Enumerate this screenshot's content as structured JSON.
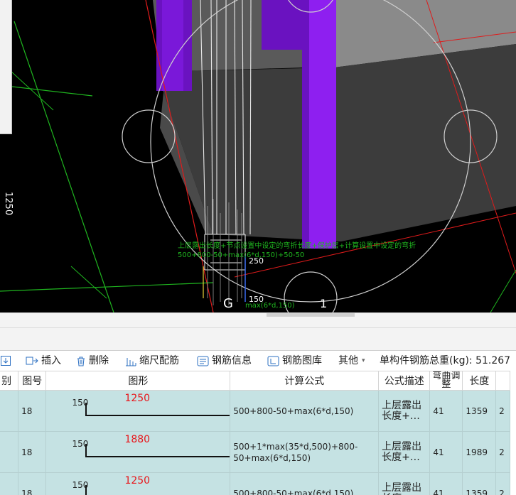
{
  "viewport": {
    "labels": {
      "axis_g": "G",
      "axis_1": "1",
      "dim_250": "250",
      "dim_150": "150",
      "side_mark": "1250",
      "note_line1": "上层露出长度+节点设置中设定的弯折长度+保护层+计算设置中设定的弯折",
      "note_line2": "500+800-50+max(6*d,150)+50-50",
      "formula_near_dim": "max(6*d,150)"
    }
  },
  "toolbar": {
    "insert": "插入",
    "delete": "删除",
    "scale_rebar": "缩尺配筋",
    "rebar_info": "钢筋信息",
    "rebar_library": "钢筋图库",
    "other": "其他",
    "weight_label": "单构件钢筋总重(kg):",
    "weight_value": "51.267"
  },
  "table": {
    "headers": {
      "type": "别",
      "figure_no": "图号",
      "shape": "图形",
      "formula": "计算公式",
      "desc": "公式描述",
      "bend_adjust": "弯曲调整",
      "length": "长度",
      "extra": ""
    },
    "rows": [
      {
        "type": "",
        "figure_no": "18",
        "shape_side": "150",
        "shape_value": "1250",
        "formula": "500+800-50+max(6*d,150)",
        "desc": "上层露出长度+…",
        "bend": "41",
        "length": "1359",
        "extra": "2"
      },
      {
        "type": "",
        "figure_no": "18",
        "shape_side": "150",
        "shape_value": "1880",
        "formula": "500+1*max(35*d,500)+800-50+max(6*d,150)",
        "desc": "上层露出长度+…",
        "bend": "41",
        "length": "1989",
        "extra": "2"
      },
      {
        "type": "",
        "figure_no": "18",
        "shape_side": "150",
        "shape_value": "1250",
        "formula": "500+800-50+max(6*d,150)",
        "desc": "上层露出长度+…",
        "bend": "41",
        "length": "1359",
        "extra": "2"
      }
    ]
  },
  "colors": {
    "viewport_bg": "#000000",
    "row_bg": "#c5e2e3",
    "purple_column": "#7a14d6",
    "grid_red": "#e01b1b",
    "grid_green": "#1fb51f",
    "shape_value": "#e8161b"
  }
}
